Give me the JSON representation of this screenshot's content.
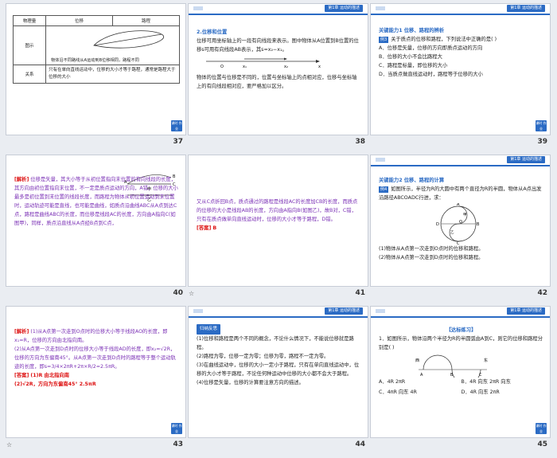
{
  "header_chip": "第1章  运动的描述",
  "corner_label": "课时 作业",
  "anim_mark": "☆",
  "s37": {
    "number": "37",
    "col_quantity": "物理量",
    "col_displacement": "位移",
    "col_path": "路程",
    "row_diagram": "图示",
    "diagram_caption": "物体沿不同路线从A运动到B位移相同，路程不同",
    "row_relation": "关系",
    "relation_text": "只有在单向直线运动中，位移的大小才等于路程，通常是路程大于位移的大小"
  },
  "s38": {
    "number": "38",
    "heading": "2.位移和位置",
    "p1": "位移可用坐标轴上的一段有向线段来表示。图中物体从A位置到B位置的位移s可用有向线段AB表示，其s=x₂−x₁。",
    "p2": "物体的位置与位移是不同的，位置与坐标轴上的点相对应，位移与坐标轴上的有向线段相对应，要严格加以区分。",
    "axis_o": "O",
    "axis_x1": "x₁",
    "axis_x2": "x₂",
    "axis_x": "x"
  },
  "s39": {
    "number": "39",
    "heading": "关键能力1  位移、路程的辨析",
    "tag": "例3",
    "question": "关于质点的位移和路程，下列说法中正确的是(     )",
    "options": [
      "A．位移是矢量，位移的方向即质点运动的方向",
      "B．位移的大小不会比路程大",
      "C．路程是标量，即位移的大小",
      "D．当质点做直线运动时，路程等于位移的大小"
    ]
  },
  "s40": {
    "number": "40",
    "label": "[解析]",
    "text": "位移是矢量，其大小等于从初位置指向末位置的有向线段的长度，其方向由初位置指向末位置，不一定是质点运动的方向，A错；位移的大小最多是初位置到末位置的线段长度，而路程为物体从初位置运动到末位置时，运动轨迹可能是直线，也可能是曲线，如质点沿曲线ABC从A点到达C点，路程是曲线ABC的长度，而位移是线段AC的长度，方向由A指向C(如图甲)，同样，质点沿直线从A点经B点到C点，",
    "fig_a": "A",
    "fig_b": "B",
    "fig_c": "C",
    "fig_jia": "甲",
    "fig_yi": "乙"
  },
  "s41": {
    "number": "41",
    "text": "又从C点折回B点，质点通过的路程是线段AC的长度加CB的长度，而质点的位移的大小是线段AB的长度，方向由A指向B(如图乙)，故B对，C错，只有在质点做单向直线运动时，位移的大小才等于路程，D错。",
    "answer_label": "[答案]",
    "answer": "B"
  },
  "s42": {
    "number": "42",
    "heading": "关键能力2  位移、路程的计算",
    "tag": "例4",
    "question": "如图所示，半径为R的大圆中有两个直径为R的半圆，物体从A点出发沿路径ABCOADC行进，求：",
    "q1": "(1)物体从A点第一次走到O点时的位移和路程。",
    "q2": "(2)物体从A点第一次走到D点时的位移和路程。",
    "fig_labels": [
      "A",
      "B",
      "C",
      "D",
      "O",
      "甲",
      "乙"
    ]
  },
  "s43": {
    "number": "43",
    "label": "[解析]",
    "p1": "(1)从A点第一次走到O点时的位移大小等于线段AO的长度，即x₁=R，位移的方向由北指向南。",
    "p2": "(2)从A点第一次走到D点时的位移大小等于线段AD的长度，即x₂=√2R，位移的方向为东偏南45°。从A点第一次走到D点时的路程等于整个运动轨迹的长度，即s=3/4×2πR+2π×R/2=2.5πR。",
    "answer_label": "[答案]",
    "a1": "(1)R  由北指向南",
    "a2": "(2)√2R，方向为东偏南45°  2.5πR"
  },
  "s44": {
    "number": "44",
    "pill": "归纳反思",
    "items": [
      "(1)位移和路程是两个不同的概念，不论什么情况下，不能说位移就是路程。",
      "(2)路程为零，位移一定为零；位移为零，路程不一定为零。",
      "(3)在曲线运动中，位移的大小一定小于路程，只有在单向直线运动中，位移的大小才等于路程，不论任何种运动中位移的大小都不会大于路程。",
      "(4)位移是矢量，位移的计算要注意方向的描述。"
    ]
  },
  "s45": {
    "number": "45",
    "heading": "【达标练习】",
    "question": "1．如图所示，物体沿两个半径为R的半圆弧由A到C，则它的位移和路程分别是(     )",
    "options": [
      "A．4R    2πR",
      "B．4R  向东    2πR  向东",
      "C．4πR  向东    4R",
      "D．4R  向东    2πR"
    ],
    "fig_labels": [
      "A",
      "B",
      "C",
      "西",
      "东"
    ]
  }
}
